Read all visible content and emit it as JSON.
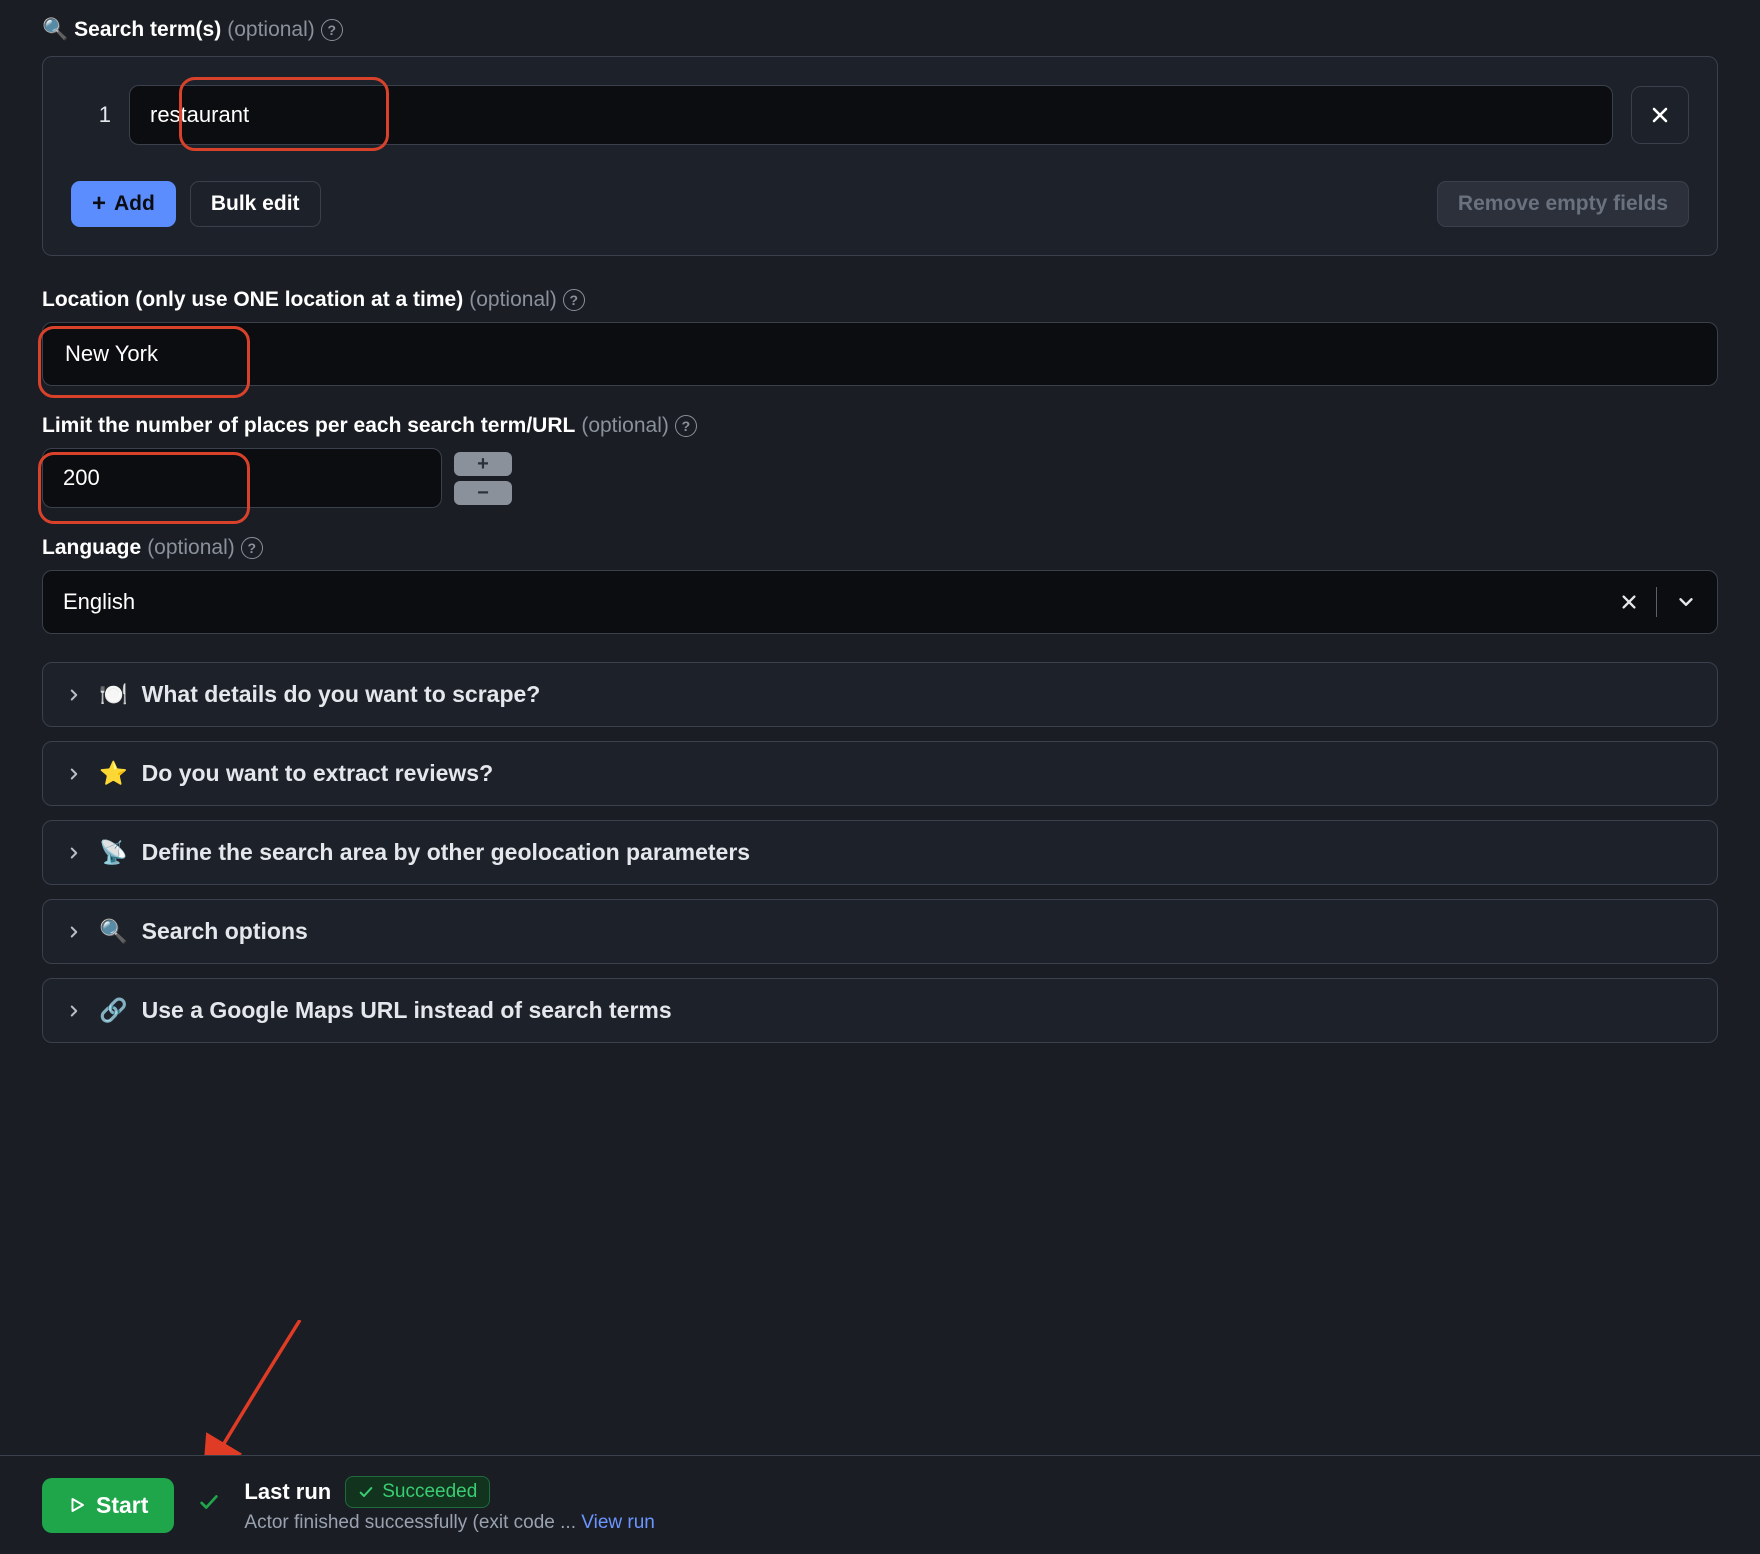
{
  "searchTerms": {
    "label": "Search term(s)",
    "optional": "(optional)",
    "rows": [
      {
        "num": "1",
        "value": "restaurant"
      }
    ],
    "addLabel": "Add",
    "bulkEditLabel": "Bulk edit",
    "removeEmptyLabel": "Remove empty fields"
  },
  "location": {
    "label": "Location (only use ONE location at a time)",
    "optional": "(optional)",
    "value": "New York"
  },
  "limit": {
    "label": "Limit the number of places per each search term/URL",
    "optional": "(optional)",
    "value": "200"
  },
  "language": {
    "label": "Language",
    "optional": "(optional)",
    "value": "English"
  },
  "accordions": [
    {
      "emoji": "🍽️",
      "label": "What details do you want to scrape?"
    },
    {
      "emoji": "⭐",
      "label": "Do you want to extract reviews?"
    },
    {
      "emoji": "📡",
      "label": "Define the search area by other geolocation parameters"
    },
    {
      "emoji": "🔍",
      "label": "Search options"
    },
    {
      "emoji": "🔗",
      "label": "Use a Google Maps URL instead of search terms"
    }
  ],
  "footer": {
    "startLabel": "Start",
    "lastRunLabel": "Last run",
    "badgeLabel": "Succeeded",
    "subText": "Actor finished successfully (exit code ...",
    "viewRunLabel": "View run"
  }
}
